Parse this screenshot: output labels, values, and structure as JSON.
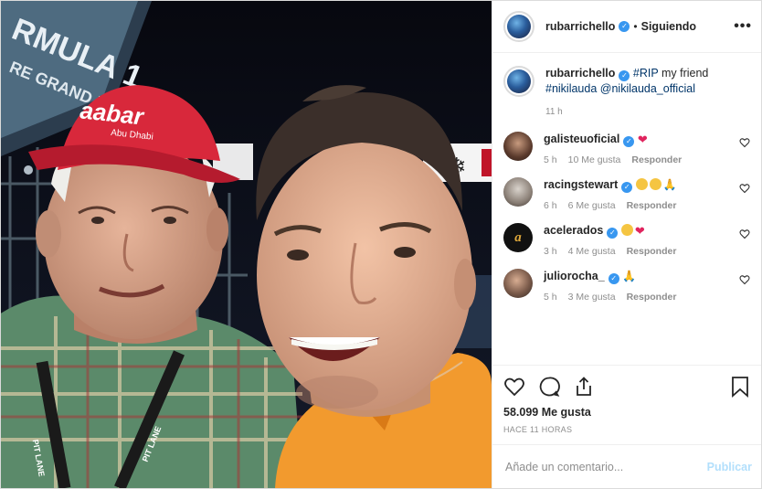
{
  "post": {
    "author": "rubarrichello",
    "separator": "•",
    "follow_status": "Siguiendo",
    "more_label": "•••"
  },
  "photo": {
    "sign_text": "RMULA 1",
    "sign_sub": "RE GRAND P",
    "cap_text": "aabar",
    "cap_sub": "Abu Dhabi",
    "lanyard_text": "PIT LANE",
    "lanyard_text_2": "PIT LANE"
  },
  "caption": {
    "author": "rubarrichello",
    "hashtag": "#RIP",
    "text": " my friend",
    "hashtag2": "#nikilauda",
    "mention": "@nikilauda_official",
    "time": "11 h"
  },
  "comments": [
    {
      "user": "galisteuoficial",
      "emojis": [
        "heart"
      ],
      "time": "5 h",
      "likes": "10 Me gusta",
      "reply": "Responder"
    },
    {
      "user": "racingstewart",
      "emojis": [
        "sad",
        "smile",
        "pray"
      ],
      "time": "6 h",
      "likes": "6 Me gusta",
      "reply": "Responder"
    },
    {
      "user": "acelerados",
      "emojis": [
        "cry",
        "heart"
      ],
      "time": "3 h",
      "likes": "4 Me gusta",
      "reply": "Responder"
    },
    {
      "user": "juliorocha_",
      "emojis": [
        "pray"
      ],
      "time": "5 h",
      "likes": "3 Me gusta",
      "reply": "Responder"
    }
  ],
  "actions": {
    "likes": "58.099 Me gusta",
    "posted": "HACE 11 HORAS"
  },
  "add_comment": {
    "placeholder": "Añade un comentario...",
    "publish": "Publicar"
  },
  "colors": {
    "verified": "#3897f0",
    "link": "#003569",
    "muted": "#8e8e8e",
    "publish_disabled": "#b2dffc"
  },
  "icons": [
    "more-icon",
    "heart-icon",
    "comment-icon",
    "share-icon",
    "bookmark-icon",
    "verified-icon"
  ]
}
